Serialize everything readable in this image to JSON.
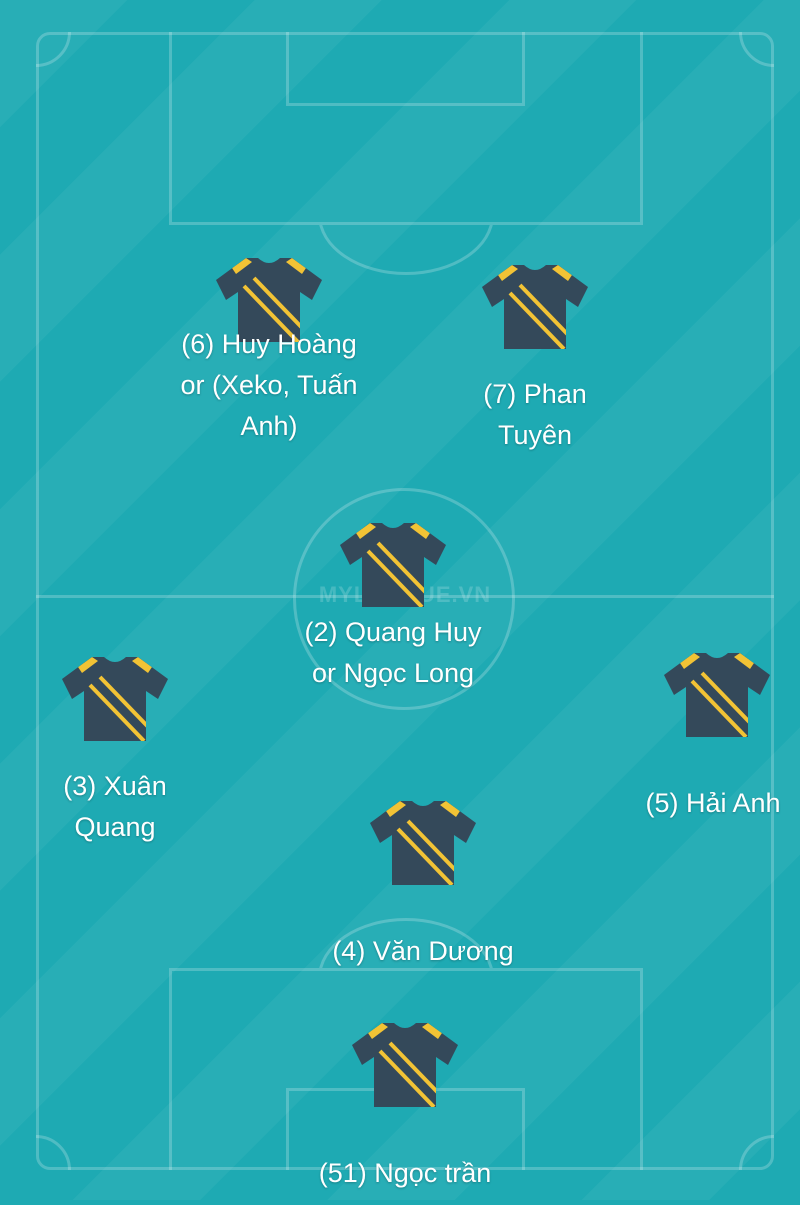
{
  "watermark": "MYLEAGUE.VN",
  "colors": {
    "pitch": "#1eaab3",
    "jersey_body": "#34495a",
    "jersey_accent": "#f2c335",
    "text": "#ffffff"
  },
  "players": [
    {
      "name": "(6) Huy Hoàng or (Xeko, Tuấn Anh)"
    },
    {
      "name": "(7) Phan Tuyên"
    },
    {
      "name": "(2) Quang Huy or Ngọc Long"
    },
    {
      "name": "(3) Xuân Quang"
    },
    {
      "name": "(5) Hải Anh"
    },
    {
      "name": "(4) Văn Dương"
    },
    {
      "name": "(51) Ngọc trần"
    }
  ]
}
